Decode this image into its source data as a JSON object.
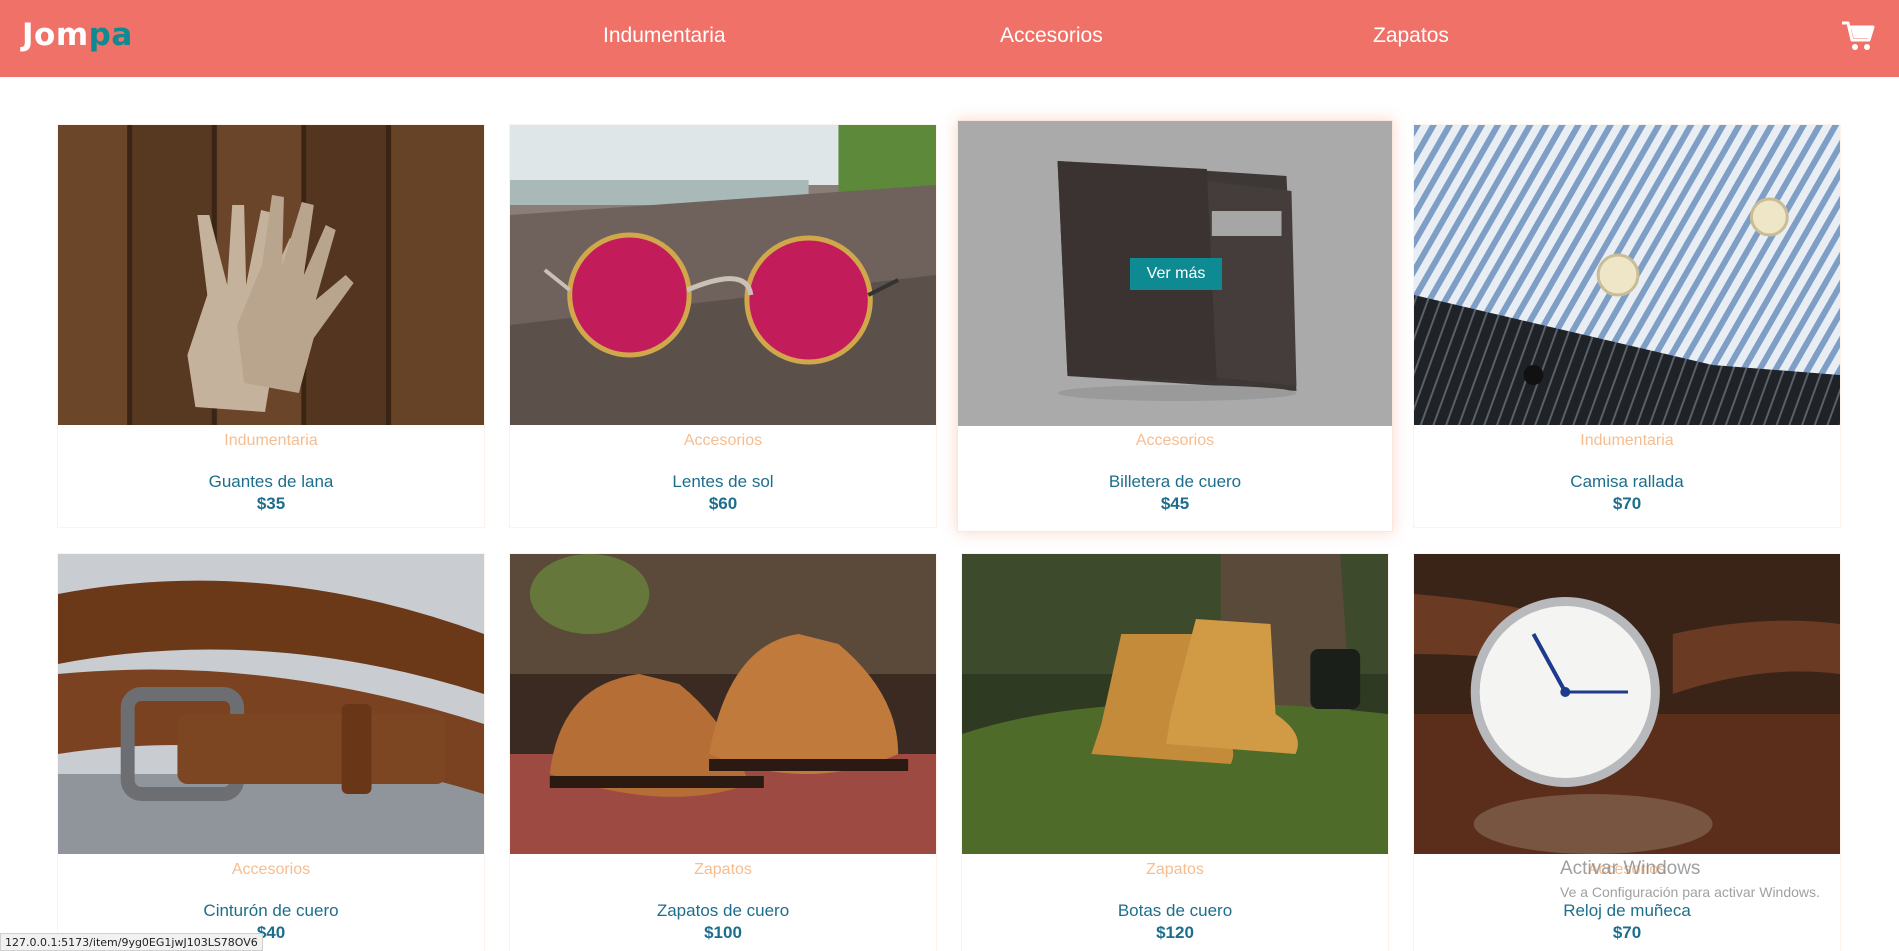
{
  "header": {
    "logo_part1": "Jom",
    "logo_part2": "pa",
    "nav": [
      {
        "label": "Indumentaria"
      },
      {
        "label": "Accesorios"
      },
      {
        "label": "Zapatos"
      }
    ],
    "cart_icon": "cart-icon"
  },
  "products": [
    {
      "category": "Indumentaria",
      "name": "Guantes de lana",
      "price": "$35"
    },
    {
      "category": "Accesorios",
      "name": "Lentes de sol",
      "price": "$60"
    },
    {
      "category": "Accesorios",
      "name": "Billetera de cuero",
      "price": "$45",
      "hovered": true,
      "button": "Ver más"
    },
    {
      "category": "Indumentaria",
      "name": "Camisa rallada",
      "price": "$70"
    },
    {
      "category": "Accesorios",
      "name": "Cinturón de cuero",
      "price": "$40"
    },
    {
      "category": "Zapatos",
      "name": "Zapatos de cuero",
      "price": "$100"
    },
    {
      "category": "Zapatos",
      "name": "Botas de cuero",
      "price": "$120"
    },
    {
      "category": "Accesorios",
      "name": "Reloj de muñeca",
      "price": "$70"
    }
  ],
  "status_bar": {
    "url": "127.0.0.1:5173/item/9yg0EG1jwJ103LS78OV6"
  },
  "windows_watermark": {
    "title": "Activar Windows",
    "subtitle": "Ve a Configuración para activar Windows."
  },
  "colors": {
    "header_bg": "#f07167",
    "accent_teal": "#0e8a92",
    "category_text": "#f6bd90",
    "product_text": "#1d6e8c"
  }
}
